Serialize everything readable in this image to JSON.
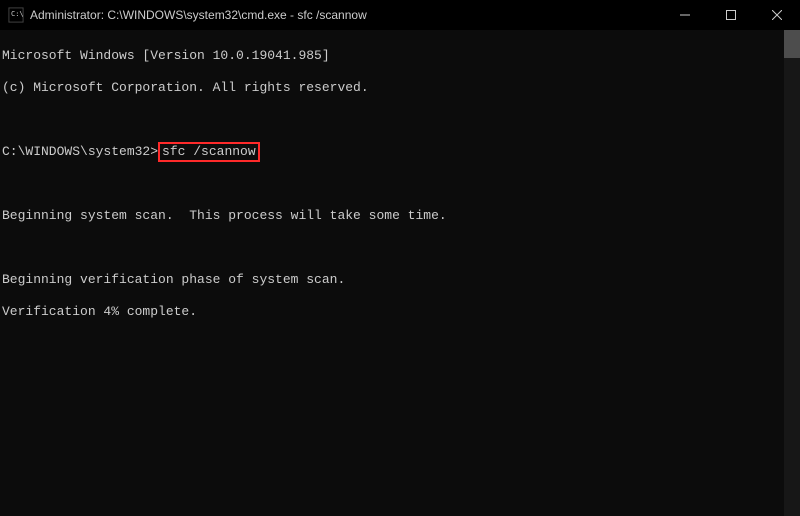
{
  "titlebar": {
    "title": "Administrator: C:\\WINDOWS\\system32\\cmd.exe - sfc  /scannow"
  },
  "terminal": {
    "line1": "Microsoft Windows [Version 10.0.19041.985]",
    "line2": "(c) Microsoft Corporation. All rights reserved.",
    "prompt": "C:\\WINDOWS\\system32>",
    "command": "sfc /scannow",
    "line3": "Beginning system scan.  This process will take some time.",
    "line4": "Beginning verification phase of system scan.",
    "line5": "Verification 4% complete."
  }
}
